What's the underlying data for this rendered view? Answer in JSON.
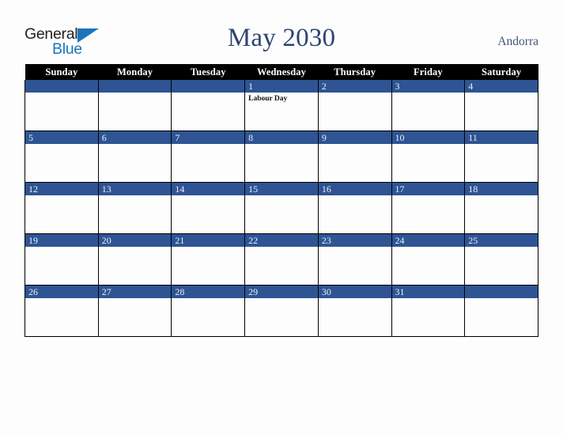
{
  "brand": {
    "line1": "General",
    "line2": "Blue",
    "triangle_icon": "blue-triangle-icon",
    "color_dark": "#231f20",
    "color_blue": "#1b75bb"
  },
  "header": {
    "title": "May 2030",
    "country": "Andorra",
    "title_color": "#2d4471",
    "country_color": "#41567f"
  },
  "calendar": {
    "weekday_headers": [
      "Sunday",
      "Monday",
      "Tuesday",
      "Wednesday",
      "Thursday",
      "Friday",
      "Saturday"
    ],
    "header_bg": "#000000",
    "header_text_color": "#ffffff",
    "date_bar_color": "#2e5494",
    "date_text_color": "#eef1f7",
    "weeks": [
      {
        "days": [
          {
            "number": "",
            "events": []
          },
          {
            "number": "",
            "events": []
          },
          {
            "number": "",
            "events": []
          },
          {
            "number": "1",
            "events": [
              "Labour Day"
            ]
          },
          {
            "number": "2",
            "events": []
          },
          {
            "number": "3",
            "events": []
          },
          {
            "number": "4",
            "events": []
          }
        ]
      },
      {
        "days": [
          {
            "number": "5",
            "events": []
          },
          {
            "number": "6",
            "events": []
          },
          {
            "number": "7",
            "events": []
          },
          {
            "number": "8",
            "events": []
          },
          {
            "number": "9",
            "events": []
          },
          {
            "number": "10",
            "events": []
          },
          {
            "number": "11",
            "events": []
          }
        ]
      },
      {
        "days": [
          {
            "number": "12",
            "events": []
          },
          {
            "number": "13",
            "events": []
          },
          {
            "number": "14",
            "events": []
          },
          {
            "number": "15",
            "events": []
          },
          {
            "number": "16",
            "events": []
          },
          {
            "number": "17",
            "events": []
          },
          {
            "number": "18",
            "events": []
          }
        ]
      },
      {
        "days": [
          {
            "number": "19",
            "events": []
          },
          {
            "number": "20",
            "events": []
          },
          {
            "number": "21",
            "events": []
          },
          {
            "number": "22",
            "events": []
          },
          {
            "number": "23",
            "events": []
          },
          {
            "number": "24",
            "events": []
          },
          {
            "number": "25",
            "events": []
          }
        ]
      },
      {
        "days": [
          {
            "number": "26",
            "events": []
          },
          {
            "number": "27",
            "events": []
          },
          {
            "number": "28",
            "events": []
          },
          {
            "number": "29",
            "events": []
          },
          {
            "number": "30",
            "events": []
          },
          {
            "number": "31",
            "events": []
          },
          {
            "number": "",
            "events": []
          }
        ]
      }
    ]
  }
}
